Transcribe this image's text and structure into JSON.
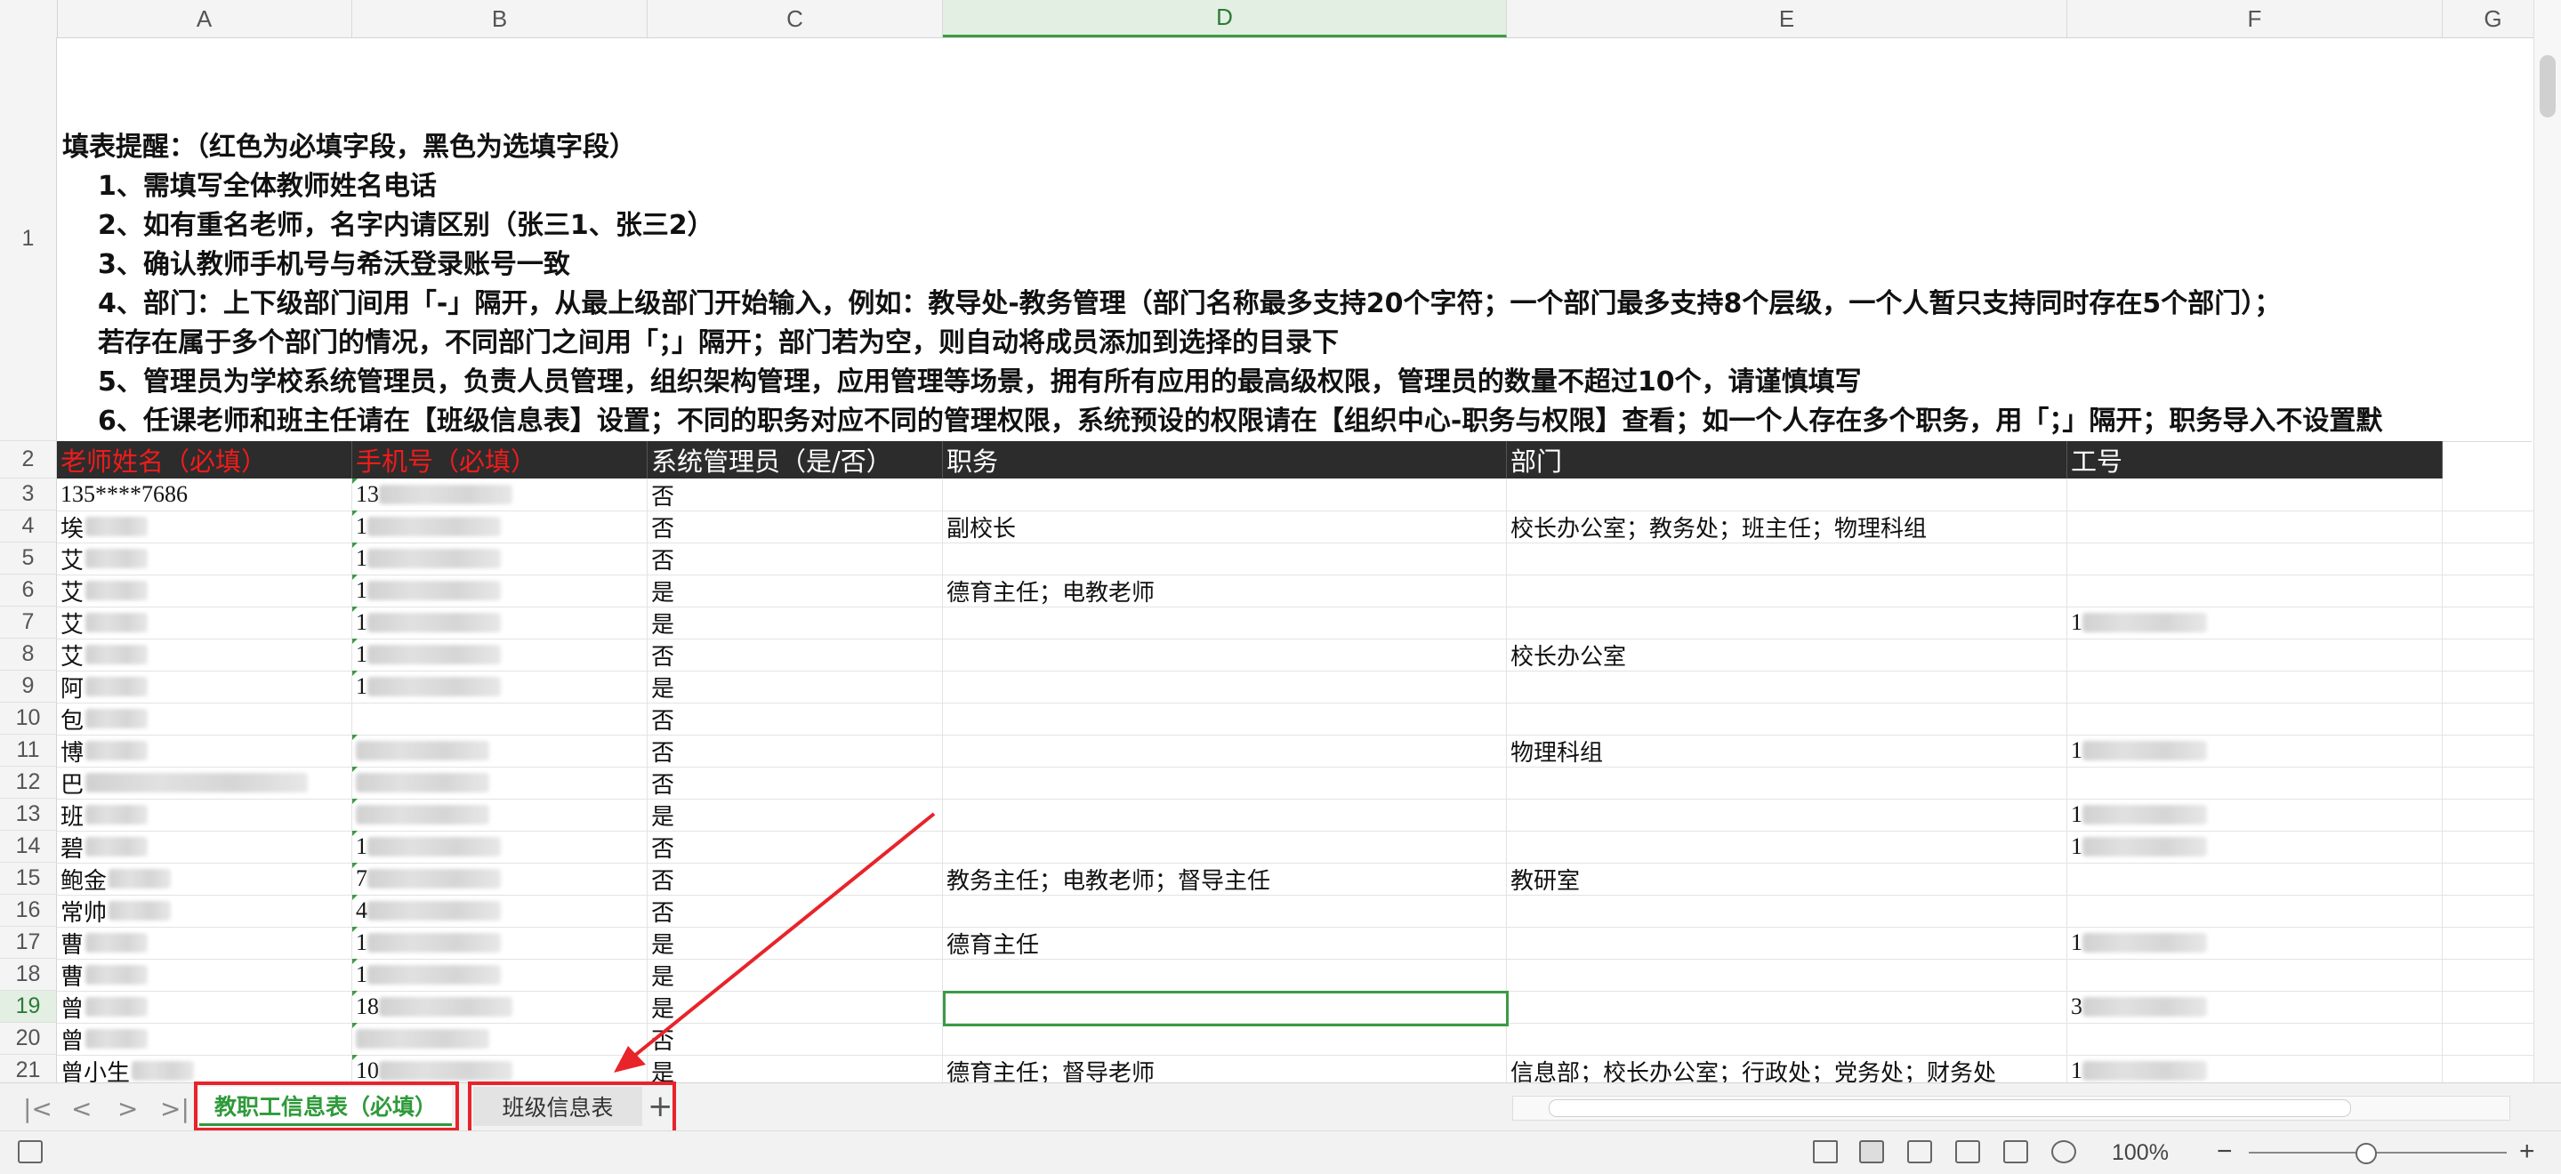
{
  "columns": [
    "A",
    "B",
    "C",
    "D",
    "E",
    "F",
    "G"
  ],
  "active_column": "D",
  "notice": {
    "title": "填表提醒：（红色为必填字段，黑色为选填字段）",
    "items": [
      "1、需填写全体教师姓名电话",
      "2、如有重名老师，名字内请区别（张三1、张三2）",
      "3、确认教师手机号与希沃登录账号一致",
      "4、部门：上下级部门间用「-」隔开，从最上级部门开始输入，例如：教导处-教务管理（部门名称最多支持20个字符；一个部门最多支持8个层级，一个人暂只支持同时存在5个部门）；",
      "若存在属于多个部门的情况，不同部门之间用「；」隔开；部门若为空，则自动将成员添加到选择的目录下",
      "5、管理员为学校系统管理员，负责人员管理，组织架构管理，应用管理等场景，拥有所有应用的最高级权限，管理员的数量不超过10个，请谨慎填写",
      "6、任课老师和班主任请在【班级信息表】设置；不同的职务对应不同的管理权限，系统预设的权限请在【组织中心-职务与权限】查看；如一个人存在多个职务，用「；」隔开；职务导入不设置默"
    ]
  },
  "header": {
    "name": "老师姓名（必填）",
    "phone": "手机号（必填）",
    "admin": "系统管理员（是/否）",
    "position": "职务",
    "department": "部门",
    "job_no": "工号"
  },
  "row_numbers": [
    "1",
    "2",
    "3",
    "4",
    "5",
    "6",
    "7",
    "8",
    "9",
    "10",
    "11",
    "12",
    "13",
    "14",
    "15",
    "16",
    "17",
    "18",
    "19",
    "20",
    "21"
  ],
  "active_row": "19",
  "rows": [
    {
      "num": "3",
      "name": "135****7686",
      "phone": "13",
      "admin": "否",
      "position": "",
      "department": "",
      "job_no": ""
    },
    {
      "num": "4",
      "name": "埃",
      "phone": "1",
      "admin": "否",
      "position": "副校长",
      "department": "校长办公室；教务处；班主任；物理科组",
      "job_no": ""
    },
    {
      "num": "5",
      "name": "艾",
      "phone": "1",
      "admin": "否",
      "position": "",
      "department": "",
      "job_no": ""
    },
    {
      "num": "6",
      "name": "艾",
      "phone": "1",
      "admin": "是",
      "position": "德育主任；电教老师",
      "department": "",
      "job_no": ""
    },
    {
      "num": "7",
      "name": "艾",
      "phone": "1",
      "admin": "是",
      "position": "",
      "department": "",
      "job_no": "1"
    },
    {
      "num": "8",
      "name": "艾",
      "phone": "1",
      "admin": "否",
      "position": "",
      "department": "校长办公室",
      "job_no": ""
    },
    {
      "num": "9",
      "name": "阿",
      "phone": "1",
      "admin": "是",
      "position": "",
      "department": "",
      "job_no": ""
    },
    {
      "num": "10",
      "name": "包",
      "phone": "",
      "admin": "否",
      "position": "",
      "department": "",
      "job_no": ""
    },
    {
      "num": "11",
      "name": "博",
      "phone": "",
      "admin": "否",
      "position": "",
      "department": "物理科组",
      "job_no": "1"
    },
    {
      "num": "12",
      "name": "巴",
      "phone": "",
      "admin": "否",
      "position": "",
      "department": "",
      "job_no": ""
    },
    {
      "num": "13",
      "name": "班",
      "phone": "",
      "admin": "是",
      "position": "",
      "department": "",
      "job_no": "1"
    },
    {
      "num": "14",
      "name": "碧",
      "phone": "1",
      "admin": "否",
      "position": "",
      "department": "",
      "job_no": "1"
    },
    {
      "num": "15",
      "name": "鲍金",
      "phone": "7",
      "admin": "否",
      "position": "教务主任；电教老师；督导主任",
      "department": "教研室",
      "job_no": ""
    },
    {
      "num": "16",
      "name": "常帅",
      "phone": "4",
      "admin": "否",
      "position": "",
      "department": "",
      "job_no": ""
    },
    {
      "num": "17",
      "name": "曹",
      "phone": "1",
      "admin": "是",
      "position": "德育主任",
      "department": "",
      "job_no": "1"
    },
    {
      "num": "18",
      "name": "曹",
      "phone": "1",
      "admin": "是",
      "position": "",
      "department": "",
      "job_no": ""
    },
    {
      "num": "19",
      "name": "曾",
      "phone": "18",
      "admin": "是",
      "position": "",
      "department": "",
      "job_no": "3"
    },
    {
      "num": "20",
      "name": "曾",
      "phone": "",
      "admin": "否",
      "position": "",
      "department": "",
      "job_no": ""
    },
    {
      "num": "21",
      "name": "曾小生",
      "phone": "10",
      "admin": "是",
      "position": "德育主任；督导老师",
      "department": "信息部；校长办公室；行政处；党务处；财务处",
      "job_no": "1"
    }
  ],
  "tabs": {
    "active": "教职工信息表（必填）",
    "other": "班级信息表",
    "add": "+"
  },
  "nav": {
    "first": "|<",
    "prev": "<",
    "next": ">",
    "last": ">|"
  },
  "status": {
    "zoom": "100%",
    "minus": "−",
    "plus": "+"
  },
  "colors": {
    "accent": "#2f9a3a",
    "required": "#ee1c1c",
    "header_bg": "#2c2c2c",
    "annotation": "#e8232a"
  }
}
